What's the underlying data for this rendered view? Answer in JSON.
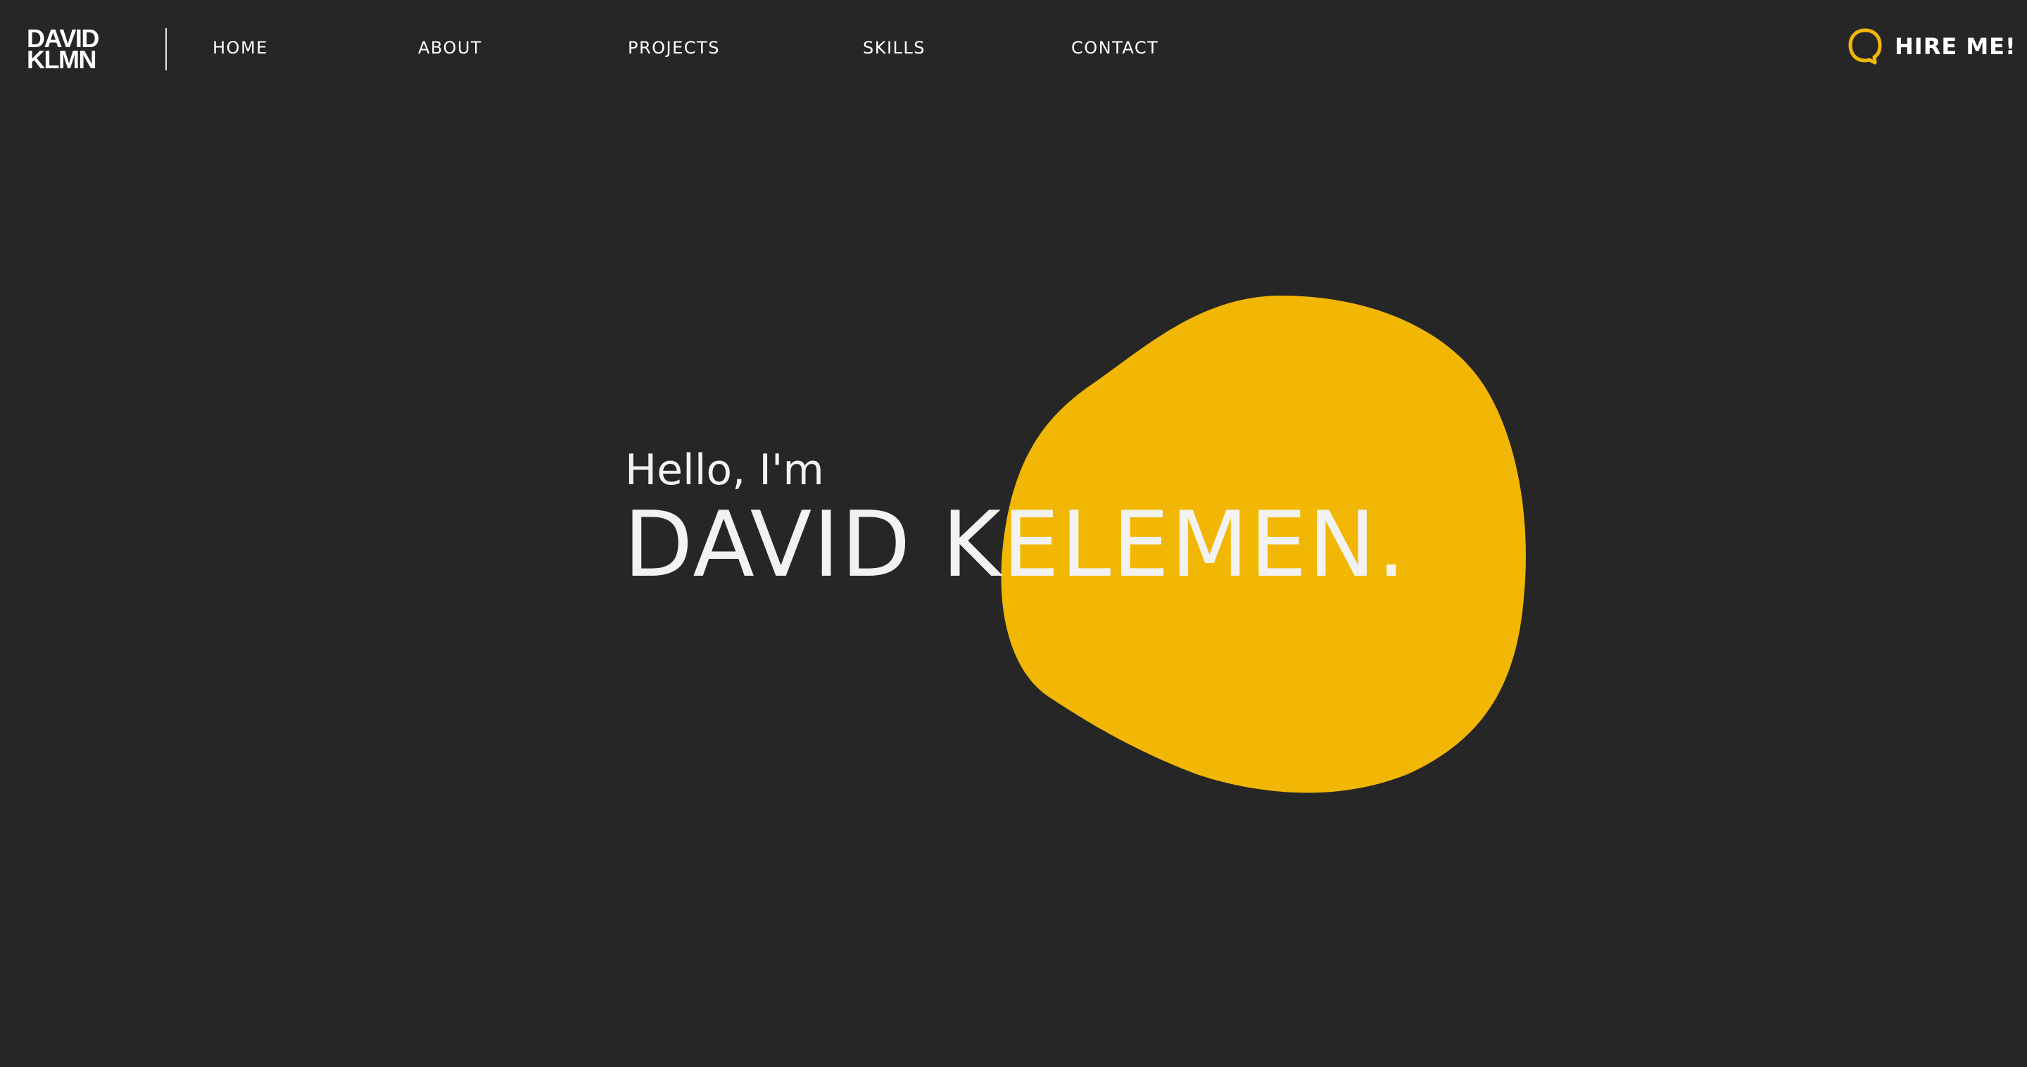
{
  "logo": {
    "line1": "DAVID",
    "line2": "KLMN"
  },
  "nav": {
    "items": [
      {
        "label": "HOME"
      },
      {
        "label": "ABOUT"
      },
      {
        "label": "PROJECTS"
      },
      {
        "label": "SKILLS"
      },
      {
        "label": "CONTACT"
      }
    ]
  },
  "cta": {
    "label": "HIRE ME!",
    "icon": "chat-bubble-icon"
  },
  "hero": {
    "greeting": "Hello, I'm",
    "name": "DAVID KELEMEN."
  },
  "colors": {
    "background": "#262626",
    "accent": "#f2b705",
    "text": "#f2f2f2"
  }
}
